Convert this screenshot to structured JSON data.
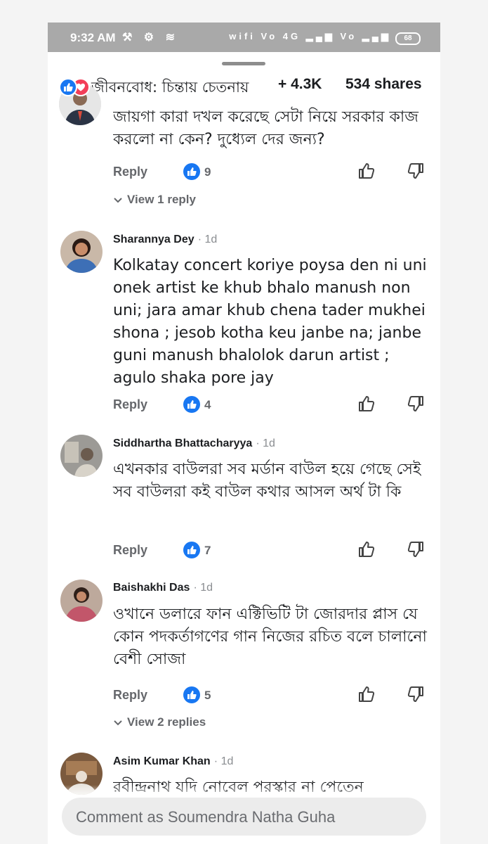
{
  "status_bar": {
    "time": "9:32 AM",
    "left_icons": "⚒ ⚙ ≋",
    "right_icons": "wifi Vo 4G ▂▄▆ Vo ▂▄▆",
    "battery": "68"
  },
  "header": {
    "page_name": "জীবনবোধ: চিন্তায় চেতনায়",
    "reactions": "+ 4.3K",
    "shares": "534 shares",
    "reaction_icons": [
      "like-icon",
      "love-icon"
    ]
  },
  "comments": [
    {
      "author": "",
      "time": "",
      "text": "জায়গা কারা দখল করেছে সেটা নিয়ে সরকার কাজ করলো না কেন? দুধ্যেল দের জন্য?",
      "reply_label": "Reply",
      "likes": "9",
      "view_replies": "View 1 reply"
    },
    {
      "author": "Sharannya Dey",
      "time": "· 1d",
      "text": "Kolkatay concert koriye poysa den ni uni onek artist ke khub bhalo manush non uni; jara amar khub chena tader mukhei shona ; jesob kotha keu janbe na; janbe guni manush bhalolok darun artist ; agulo shaka pore jay",
      "reply_label": "Reply",
      "likes": "4"
    },
    {
      "author": "Siddhartha Bhattacharyya",
      "time": "· 1d",
      "text": "এখনকার বাউলরা সব মর্ডান বাউল হয়ে গেছে সেই সব বাউলরা কই  বাউল কথার আসল অর্থ টা কি",
      "reply_label": "Reply",
      "likes": "7"
    },
    {
      "author": "Baishakhi Das",
      "time": "· 1d",
      "text": "ওখানে ডলারে ফান এক্টিভিটি টা জোরদার প্লাস যে কোন পদকর্তাগণের গান নিজের রচিত বলে চালানো বেশী সোজা",
      "reply_label": "Reply",
      "likes": "5",
      "view_replies": "View 2 replies"
    },
    {
      "author": "Asim Kumar Khan",
      "time": "· 1d",
      "text": "রবীন্দ্রনাথ যদি নোবেল পুরস্কার না পেতেন"
    }
  ],
  "comment_bar": {
    "placeholder": "Comment as Soumendra Natha Guha"
  },
  "colors": {
    "facebook_blue": "#1877f2",
    "love_red": "#f33e58",
    "status_bar": "#a9a9a9",
    "secondary_text": "#65676b"
  }
}
